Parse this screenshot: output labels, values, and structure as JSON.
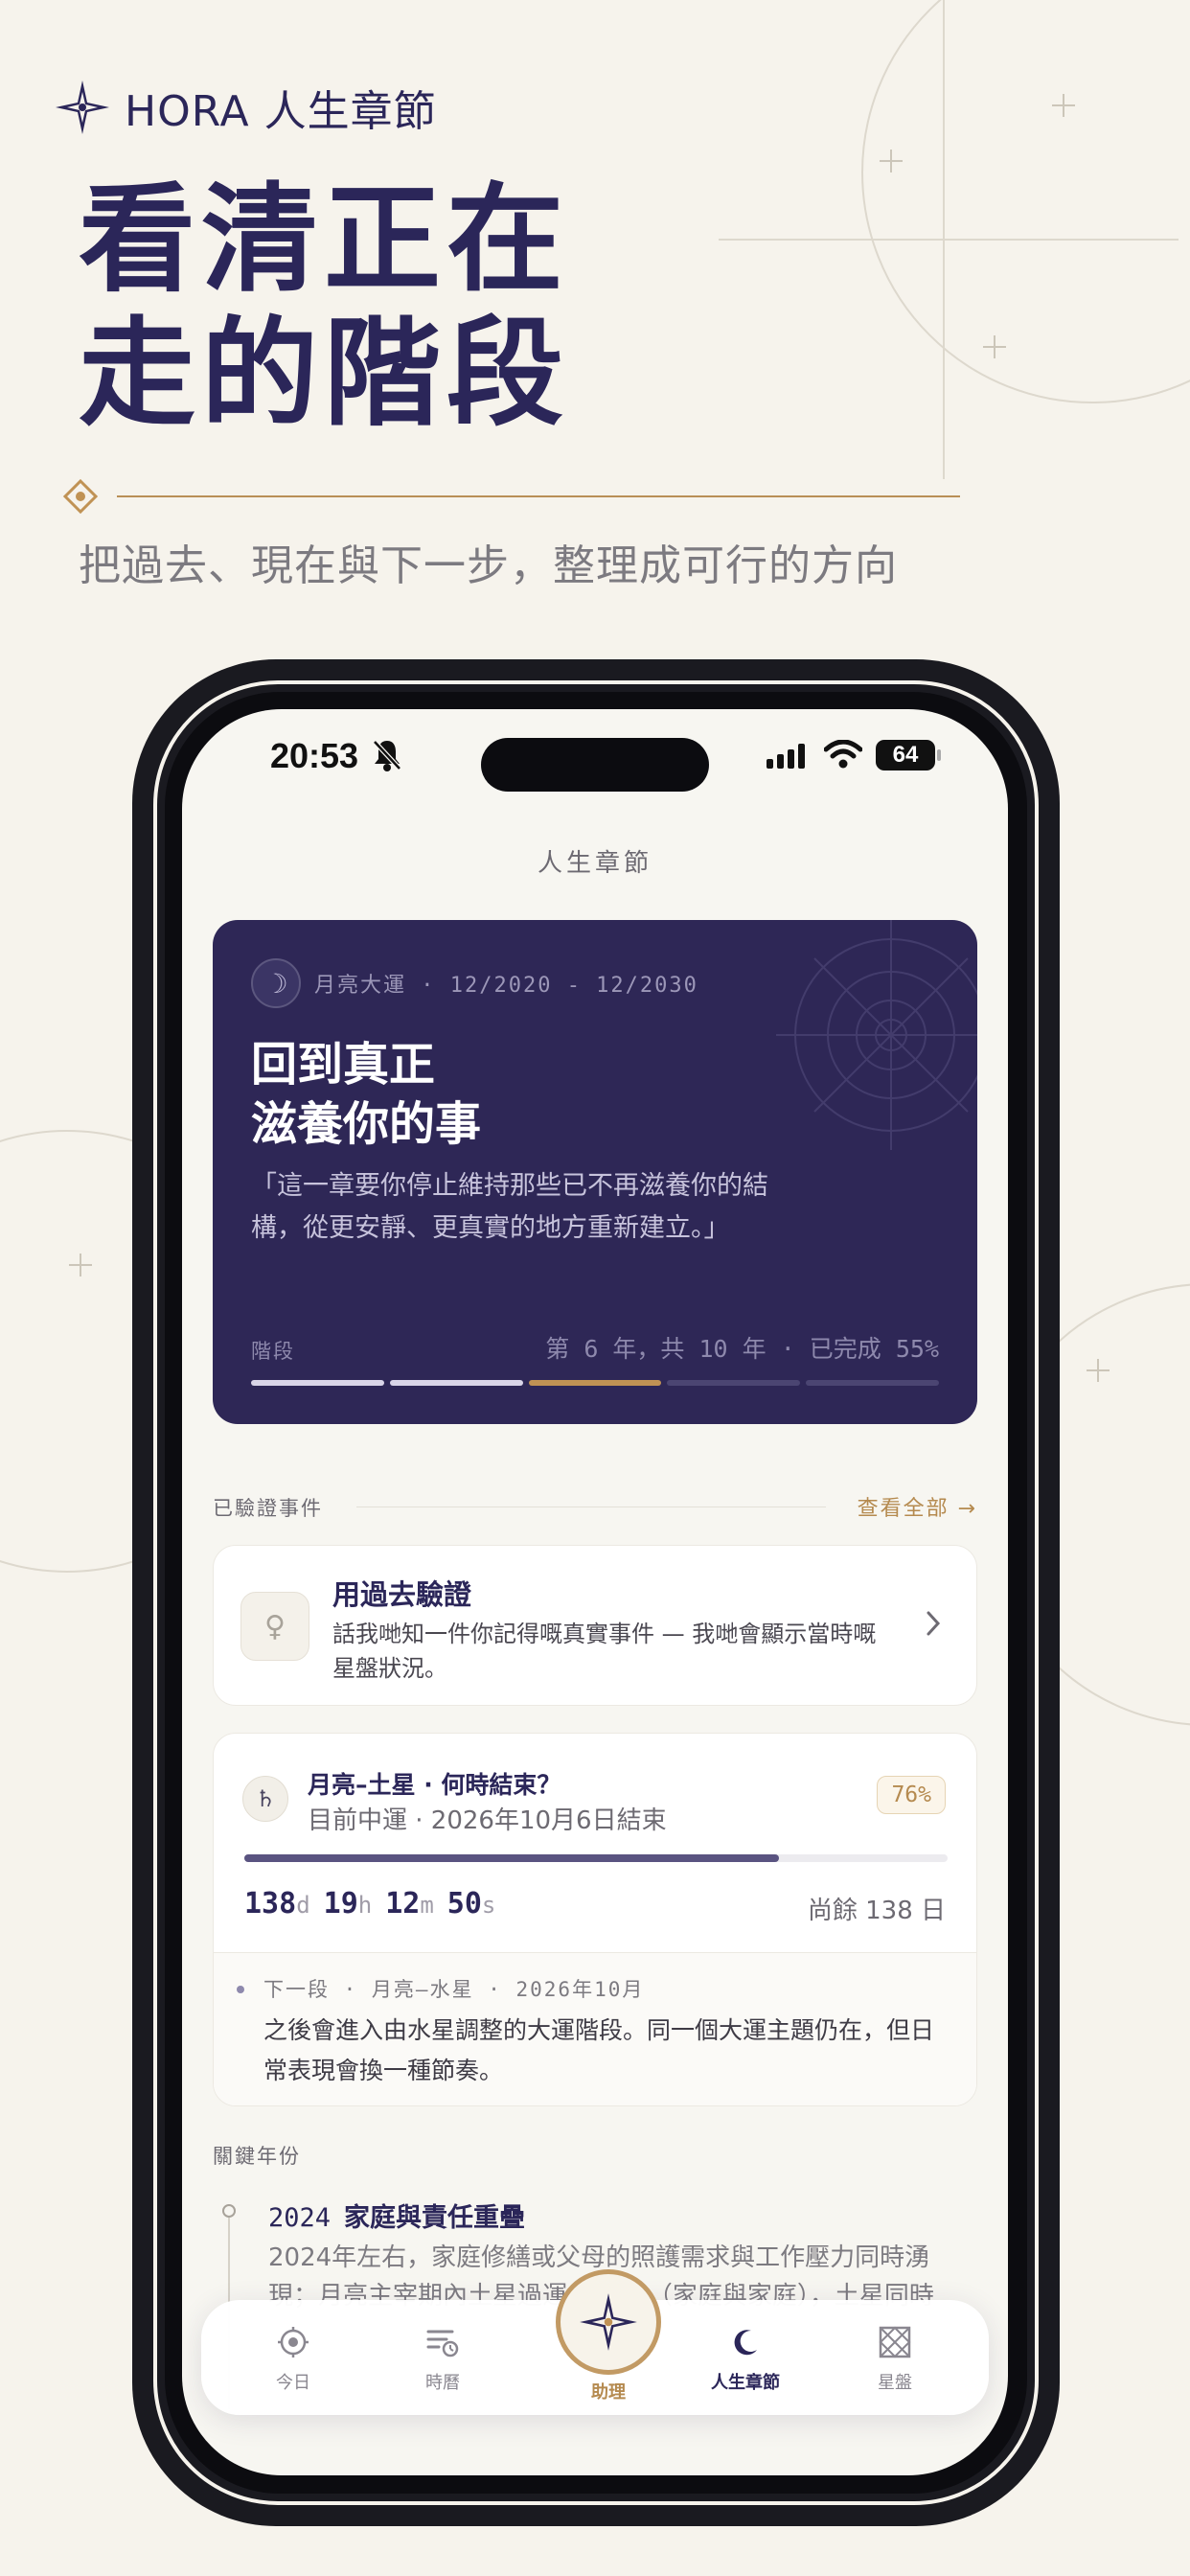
{
  "promo": {
    "brand": "HORA 人生章節",
    "headline_line1": "看清正在",
    "headline_line2": "走的階段",
    "subtitle": "把過去、現在與下一步，整理成可行的方向"
  },
  "status_bar": {
    "time": "20:53",
    "battery": "64"
  },
  "app": {
    "title": "人生章節"
  },
  "hero": {
    "period": "月亮大運 · 12/2020 - 12/2030",
    "title_line1": "回到真正",
    "title_line2": "滋養你的事",
    "quote": "「這一章要你停止維持那些已不再滋養你的結構，從更安靜、更真實的地方重新建立。」",
    "stage_label": "階段",
    "stage_info": "第 6 年，共 10 年 · 已完成 55%",
    "progress_percent": 55,
    "stage_segments": [
      "done",
      "done",
      "current",
      "pending",
      "pending"
    ]
  },
  "verified": {
    "section_label": "已驗證事件",
    "view_all": "查看全部 →",
    "card_title": "用過去驗證",
    "card_desc": "話我哋知一件你記得嘅真實事件 — 我哋會顯示當時嘅星盤狀況。"
  },
  "transit": {
    "title": "月亮–土星 · 何時結束？",
    "subtitle": "目前中運 · 2026年10月6日結束",
    "percent_label": "76%",
    "progress_fraction": 0.76,
    "countdown": {
      "days": "138",
      "d_unit": "d",
      "hours": "19",
      "h_unit": "h",
      "minutes": "12",
      "m_unit": "m",
      "seconds": "50",
      "s_unit": "s"
    },
    "remaining": "尚餘 138 日",
    "next_label": "下一段 · 月亮–水星 · 2026年10月",
    "next_text": "之後會進入由水星調整的大運階段。同一個大運主題仍在，但日常表現會換一種節奏。"
  },
  "key_years": {
    "section_label": "關鍵年份",
    "items": [
      {
        "year": "2024",
        "title": "家庭與責任重疊",
        "text": "2024年左右，家庭修繕或父母的照護需求與工作壓力同時湧現；月亮主宰期內土星過運 ... 2宮（家庭與家庭），土星同時"
      }
    ]
  },
  "tab_bar": {
    "tabs": [
      {
        "label": "今日",
        "icon": "target-icon"
      },
      {
        "label": "時曆",
        "icon": "calendar-list-icon"
      },
      {
        "label": "助理",
        "icon": "compass-star-icon"
      },
      {
        "label": "人生章節",
        "icon": "crescent-moon-icon"
      },
      {
        "label": "星盤",
        "icon": "chart-grid-icon"
      }
    ],
    "active": "人生章節"
  },
  "colors": {
    "navy": "#2e2756",
    "gold": "#c09254",
    "background": "#f6f3ec"
  }
}
